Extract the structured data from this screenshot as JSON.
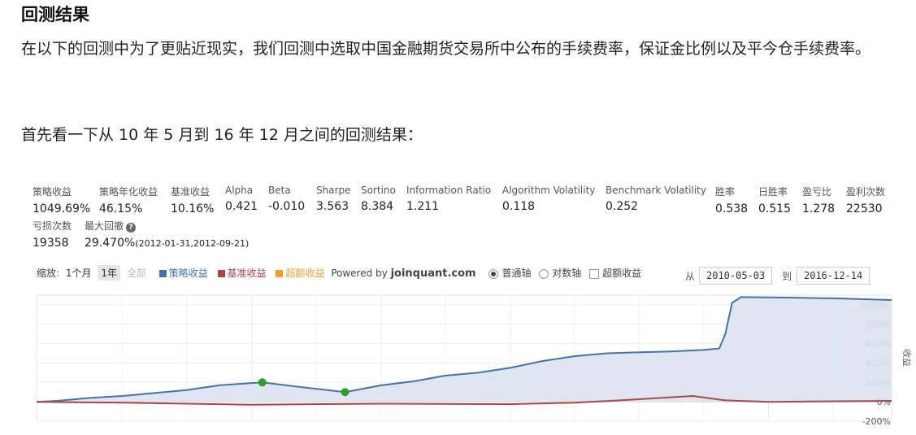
{
  "heading": "回测结果",
  "intro": "在以下的回测中为了更贴近现实，我们回测中选取中国金融期货交易所中公布的手续费率，保证金比例以及平今仓手续费率。",
  "subheading": "首先看一下从 10 年 5 月到 16 年 12 月之间的回测结果：",
  "stats": [
    {
      "label": "策略收益",
      "value": "1049.69%"
    },
    {
      "label": "策略年化收益",
      "value": "46.15%"
    },
    {
      "label": "基准收益",
      "value": "10.16%"
    },
    {
      "label": "Alpha",
      "value": "0.421"
    },
    {
      "label": "Beta",
      "value": "-0.010"
    },
    {
      "label": "Sharpe",
      "value": "3.563"
    },
    {
      "label": "Sortino",
      "value": "8.384"
    },
    {
      "label": "Information Ratio",
      "value": "1.211"
    },
    {
      "label": "Algorithm Volatility",
      "value": "0.118"
    },
    {
      "label": "Benchmark Volatility",
      "value": "0.252"
    },
    {
      "label": "胜率",
      "value": "0.538"
    },
    {
      "label": "日胜率",
      "value": "0.515"
    },
    {
      "label": "盈亏比",
      "value": "1.278"
    },
    {
      "label": "盈利次数",
      "value": "22530"
    }
  ],
  "stats2": [
    {
      "label": "亏损次数",
      "value": "19358"
    },
    {
      "label": "最大回撤",
      "value": "29.470%",
      "note": "(2012-01-31,2012-09-21)",
      "icon": "help-icon"
    }
  ],
  "toolbar": {
    "zoom_label": "缩放:",
    "zoom_options": [
      "1个月",
      "1年",
      "全部"
    ],
    "legend": [
      {
        "label": "策略收益",
        "color": "#4572a7"
      },
      {
        "label": "基准收益",
        "color": "#aa4643"
      },
      {
        "label": "超额收益",
        "color": "#f0a030"
      }
    ],
    "powered_prefix": "Powered by",
    "powered_brand": "joinquant.com",
    "axis_modes": [
      "普通轴",
      "对数轴"
    ],
    "excess_toggle": "超额收益",
    "from_label": "从",
    "from_date": "2010-05-03",
    "to_label": "到",
    "to_date": "2016-12-14"
  },
  "chart_data": {
    "type": "line",
    "x_range": [
      "2010-05-03",
      "2016-12-14"
    ],
    "ylim": [
      -200,
      1100
    ],
    "ytick_labels": [
      "1000%",
      "800%",
      "600%",
      "400%",
      "200%",
      "0%",
      "-200%"
    ],
    "yticks": [
      1000,
      800,
      600,
      400,
      200,
      0,
      -200
    ],
    "ylabel": "收益",
    "grid": true,
    "series": [
      {
        "name": "策略收益",
        "color": "#4572a7",
        "fill": "#dbe3ef",
        "points": [
          [
            "2010-05-03",
            0
          ],
          [
            "2010-07-01",
            10
          ],
          [
            "2010-10-01",
            40
          ],
          [
            "2011-01-01",
            60
          ],
          [
            "2011-04-01",
            90
          ],
          [
            "2011-07-01",
            120
          ],
          [
            "2011-10-01",
            170
          ],
          [
            "2012-01-31",
            200
          ],
          [
            "2012-05-01",
            160
          ],
          [
            "2012-09-21",
            100
          ],
          [
            "2013-01-01",
            170
          ],
          [
            "2013-04-01",
            210
          ],
          [
            "2013-07-01",
            270
          ],
          [
            "2013-10-01",
            300
          ],
          [
            "2014-01-01",
            350
          ],
          [
            "2014-04-01",
            420
          ],
          [
            "2014-07-01",
            470
          ],
          [
            "2014-10-01",
            500
          ],
          [
            "2015-01-01",
            510
          ],
          [
            "2015-04-01",
            520
          ],
          [
            "2015-07-01",
            535
          ],
          [
            "2015-08-15",
            550
          ],
          [
            "2015-09-01",
            700
          ],
          [
            "2015-09-20",
            1020
          ],
          [
            "2015-10-15",
            1080
          ],
          [
            "2016-03-01",
            1075
          ],
          [
            "2016-08-01",
            1065
          ],
          [
            "2016-12-14",
            1050
          ]
        ]
      },
      {
        "name": "基准收益",
        "color": "#aa4643",
        "points": [
          [
            "2010-05-03",
            0
          ],
          [
            "2011-01-01",
            -10
          ],
          [
            "2012-01-01",
            -30
          ],
          [
            "2013-01-01",
            -20
          ],
          [
            "2014-01-01",
            -25
          ],
          [
            "2014-07-01",
            -10
          ],
          [
            "2014-12-01",
            20
          ],
          [
            "2015-06-01",
            60
          ],
          [
            "2015-09-01",
            15
          ],
          [
            "2016-01-01",
            0
          ],
          [
            "2016-06-01",
            5
          ],
          [
            "2016-12-14",
            10
          ]
        ]
      }
    ],
    "markers": [
      {
        "date": "2012-01-31",
        "value": 200,
        "color": "#2ca02c"
      },
      {
        "date": "2012-09-21",
        "value": 100,
        "color": "#2ca02c"
      }
    ]
  }
}
